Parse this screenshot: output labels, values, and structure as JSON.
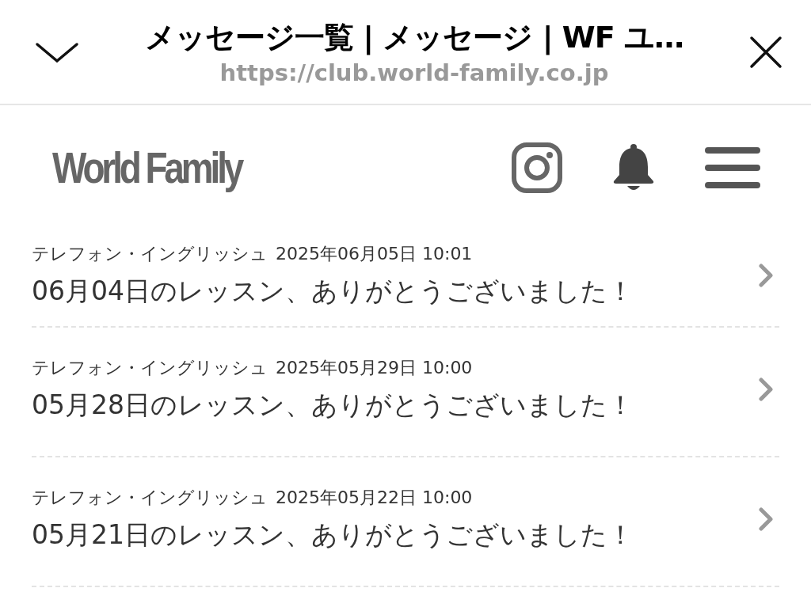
{
  "browser_bar": {
    "title": "メッセージ一覧 | メッセージ | WF ユ…",
    "url": "https://club.world-family.co.jp"
  },
  "header": {
    "logo": "World Family"
  },
  "messages": [
    {
      "sender": "テレフォン・イングリッシュ",
      "date": "2025年06月05日 10:01",
      "subject": "06月04日のレッスン、ありがとうございました！"
    },
    {
      "sender": "テレフォン・イングリッシュ",
      "date": "2025年05月29日 10:00",
      "subject": "05月28日のレッスン、ありがとうございました！"
    },
    {
      "sender": "テレフォン・イングリッシュ",
      "date": "2025年05月22日 10:00",
      "subject": "05月21日のレッスン、ありがとうございました！"
    }
  ]
}
